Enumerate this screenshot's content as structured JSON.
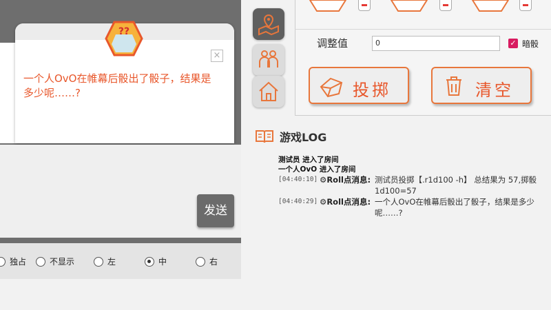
{
  "popup": {
    "badge_text": "??",
    "message": "一个人OvO在帷幕后骰出了骰子，结果是多少呢……?",
    "close_label": "×"
  },
  "composer": {
    "send_label": "发送"
  },
  "display_options": [
    {
      "label": "独占",
      "selected": false
    },
    {
      "label": "不显示",
      "selected": false
    },
    {
      "label": "左",
      "selected": false
    },
    {
      "label": "中",
      "selected": true
    },
    {
      "label": "右",
      "selected": false
    }
  ],
  "sidebar_icons": [
    "location-map-icon",
    "players-icon",
    "house-icon"
  ],
  "dice_panel": {
    "adjust_label": "调整值",
    "adjust_value": "0",
    "dark_roll_label": "暗骰",
    "dark_roll_checked": true,
    "roll_label": "投掷",
    "clear_label": "清空"
  },
  "game_log": {
    "title": "游戏LOG",
    "system_lines": [
      "测试员 进入了房间",
      "一个人OvO 进入了房间"
    ],
    "entries": [
      {
        "time": "[04:40:10]",
        "type": "Roll点消息:",
        "text": "测试员投掷【.r1d100 -h】 总结果为 57,掷骰1d100=57"
      },
      {
        "time": "[04:40:29]",
        "type": "Roll点消息:",
        "text": "一个人OvO在帷幕后骰出了骰子，结果是多少呢……?"
      }
    ]
  },
  "colors": {
    "accent": "#e8572b",
    "check": "#d81b60"
  }
}
